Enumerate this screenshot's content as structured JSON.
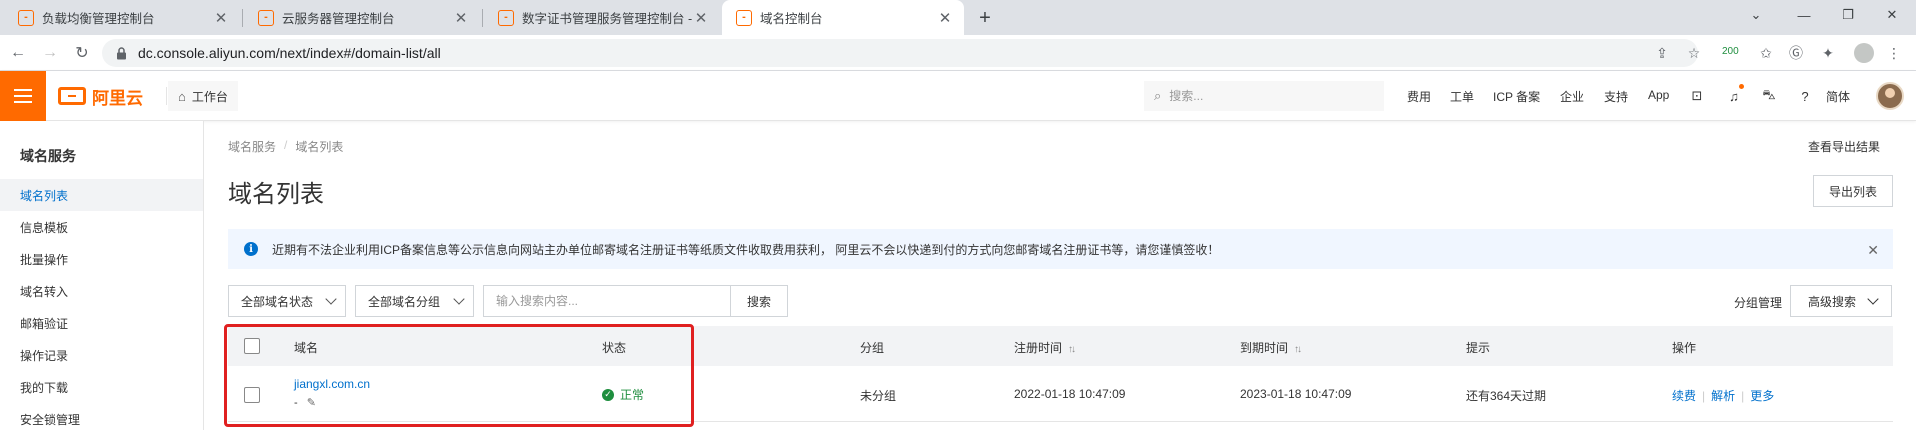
{
  "browser": {
    "tabs": [
      {
        "title": "负载均衡管理控制台",
        "active": false
      },
      {
        "title": "云服务器管理控制台",
        "active": false
      },
      {
        "title": "数字证书管理服务管理控制台 - SSL",
        "active": false
      },
      {
        "title": "域名控制台",
        "active": true
      }
    ],
    "new_tab_icon": "+",
    "url": "dc.console.aliyun.com/next/index#/domain-list/all",
    "ext_badge": "200"
  },
  "console_nav": {
    "logo_text": "阿里云",
    "workbench_label": "工作台",
    "search_placeholder": "搜索...",
    "items": [
      "费用",
      "工单",
      "ICP 备案",
      "企业",
      "支持",
      "App"
    ],
    "language": "简体"
  },
  "sidebar": {
    "title": "域名服务",
    "items": [
      {
        "label": "域名列表",
        "active": true
      },
      {
        "label": "信息模板",
        "active": false
      },
      {
        "label": "批量操作",
        "active": false
      },
      {
        "label": "域名转入",
        "active": false
      },
      {
        "label": "邮箱验证",
        "active": false
      },
      {
        "label": "操作记录",
        "active": false
      },
      {
        "label": "我的下载",
        "active": false
      },
      {
        "label": "安全锁管理",
        "active": false
      }
    ]
  },
  "main": {
    "breadcrumb": [
      "域名服务",
      "域名列表"
    ],
    "export_result_link": "查看导出结果",
    "page_title": "域名列表",
    "export_button": "导出列表",
    "notice": "近期有不法企业利用ICP备案信息等公示信息向网站主办单位邮寄域名注册证书等纸质文件收取费用获利， 阿里云不会以快递到付的方式向您邮寄域名注册证书等，请您谨慎签收！",
    "filters": {
      "status_dropdown": "全部域名状态",
      "group_dropdown": "全部域名分组",
      "search_placeholder": "输入搜索内容...",
      "search_button": "搜索",
      "group_manage": "分组管理",
      "advanced_search": "高级搜索"
    },
    "table": {
      "columns": [
        "域名",
        "状态",
        "分组",
        "注册时间",
        "到期时间",
        "提示",
        "操作"
      ],
      "rows": [
        {
          "domain": "jiangxl.com.cn",
          "remark": "-",
          "status": "正常",
          "group": "未分组",
          "registered": "2022-01-18 10:47:09",
          "expires": "2023-01-18 10:47:09",
          "hint": "还有364天过期",
          "actions": [
            "续费",
            "解析",
            "更多"
          ]
        }
      ]
    }
  },
  "colors": {
    "brand": "#ff6a00",
    "link": "#0070cc",
    "success": "#1e8e3e",
    "highlight": "#e02020"
  }
}
